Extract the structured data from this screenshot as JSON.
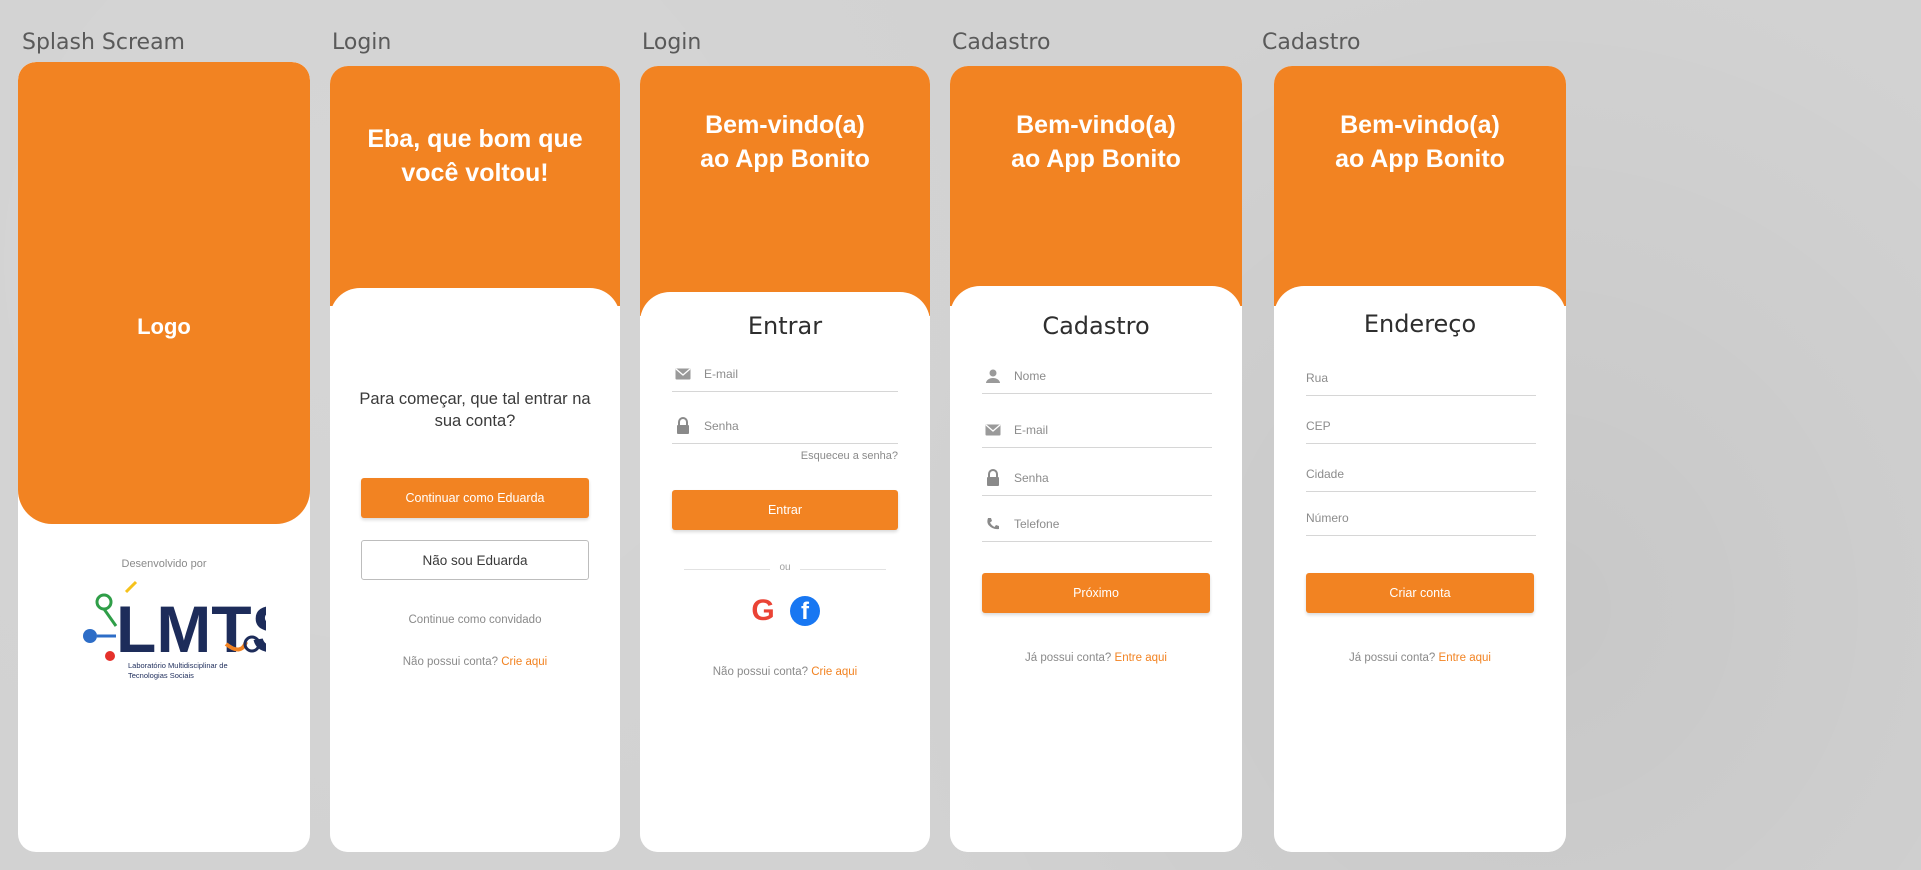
{
  "colors": {
    "accent": "#f28322",
    "background": "#d4d4d4",
    "card": "#ffffff"
  },
  "frames": {
    "splash": {
      "label": "Splash Scream",
      "logo_text": "Logo",
      "developed_by": "Desenvolvido por",
      "brand_letters": "LMTS",
      "brand_caption": "Laboratório Multidisciplinar de Tecnologias Sociais"
    },
    "login_welcome": {
      "label": "Login",
      "hero_title": "Eba, que bom que\nvocê voltou!",
      "prompt": "Para começar, que tal entrar na sua conta?",
      "continue_as_label": "Continuar como Eduarda",
      "not_user_label": "Não sou Eduarda",
      "guest_label": "Continue como convidado",
      "no_account_text": "Não possui conta?",
      "create_link": "Crie aqui"
    },
    "login_form": {
      "label": "Login",
      "hero_title": "Bem-vindo(a)\nao App Bonito",
      "card_title": "Entrar",
      "email_placeholder": "E-mail",
      "password_placeholder": "Senha",
      "forgot_password": "Esqueceu a senha?",
      "submit_label": "Entrar",
      "divider_text": "ou",
      "google_icon": "google-icon",
      "google_glyph": "G",
      "facebook_icon": "facebook-icon",
      "facebook_glyph": "f",
      "no_account_text": "Não possui conta?",
      "create_link": "Crie aqui"
    },
    "register": {
      "label": "Cadastro",
      "hero_title": "Bem-vindo(a)\nao App Bonito",
      "card_title": "Cadastro",
      "name_placeholder": "Nome",
      "email_placeholder": "E-mail",
      "password_placeholder": "Senha",
      "phone_placeholder": "Telefone",
      "next_label": "Próximo",
      "has_account_text": "Já possui conta?",
      "login_link": "Entre aqui"
    },
    "address": {
      "label": "Cadastro",
      "hero_title": "Bem-vindo(a)\nao App Bonito",
      "card_title": "Endereço",
      "street_placeholder": "Rua",
      "zip_placeholder": "CEP",
      "city_placeholder": "Cidade",
      "number_placeholder": "Número",
      "create_label": "Criar conta",
      "has_account_text": "Já possui conta?",
      "login_link": "Entre aqui"
    }
  }
}
